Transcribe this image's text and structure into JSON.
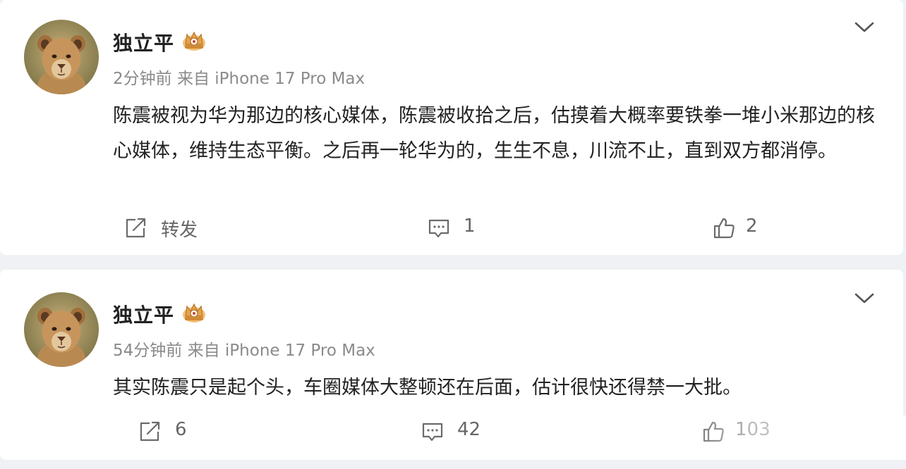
{
  "posts": [
    {
      "author": "独立平",
      "time": "2分钟前",
      "source": "来自 iPhone 17 Pro Max",
      "content": "陈震被视为华为那边的核心媒体，陈震被收拾之后，估摸着大概率要铁拳一堆小米那边的核心媒体，维持生态平衡。之后再一轮华为的，生生不息，川流不止，直到双方都消停。",
      "actions": {
        "repost": "转发",
        "comments": "1",
        "likes": "2"
      }
    },
    {
      "author": "独立平",
      "time": "54分钟前",
      "source": "来自 iPhone 17 Pro Max",
      "content": "其实陈震只是起个头，车圈媒体大整顿还在后面，估计很快还得禁一大批。",
      "actions": {
        "repost": "6",
        "comments": "42",
        "likes": "103"
      }
    }
  ],
  "icons": {
    "avatar": "lion-cub-avatar",
    "badge": "crown-badge-icon",
    "menu": "chevron-down-icon",
    "repost": "repost-icon",
    "comment": "comment-icon",
    "like": "thumbs-up-icon"
  },
  "colors": {
    "page_bg": "#f0f1f4",
    "card_bg": "#ffffff",
    "meta_text": "#8a8a8a",
    "badge_gold": "#e0a34a"
  }
}
